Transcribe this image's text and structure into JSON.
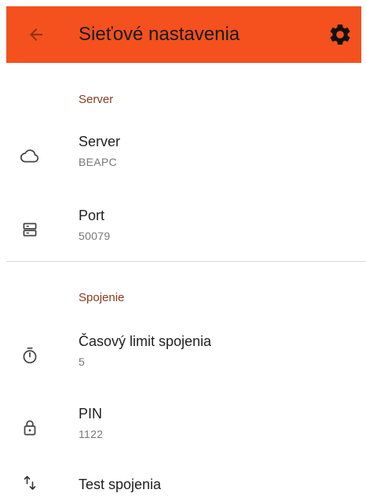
{
  "header": {
    "title": "Sieťové nastavenia",
    "back_icon": "arrow-left-icon",
    "settings_icon": "gear-icon",
    "background_color": "#F4511E"
  },
  "sections": [
    {
      "header": "Server",
      "items": [
        {
          "icon": "cloud-icon",
          "label": "Server",
          "value": "BEAPC"
        },
        {
          "icon": "server-icon",
          "label": "Port",
          "value": "50079"
        }
      ]
    },
    {
      "header": "Spojenie",
      "items": [
        {
          "icon": "timer-icon",
          "label": "Časový limit spojenia",
          "value": "5"
        },
        {
          "icon": "lock-icon",
          "label": "PIN",
          "value": "1122"
        },
        {
          "icon": "swap-vertical-icon",
          "label": "Test spojenia"
        }
      ]
    }
  ],
  "colors": {
    "accent": "#F4511E",
    "section_header": "#8B3A1A",
    "secondary_text": "#777777"
  }
}
